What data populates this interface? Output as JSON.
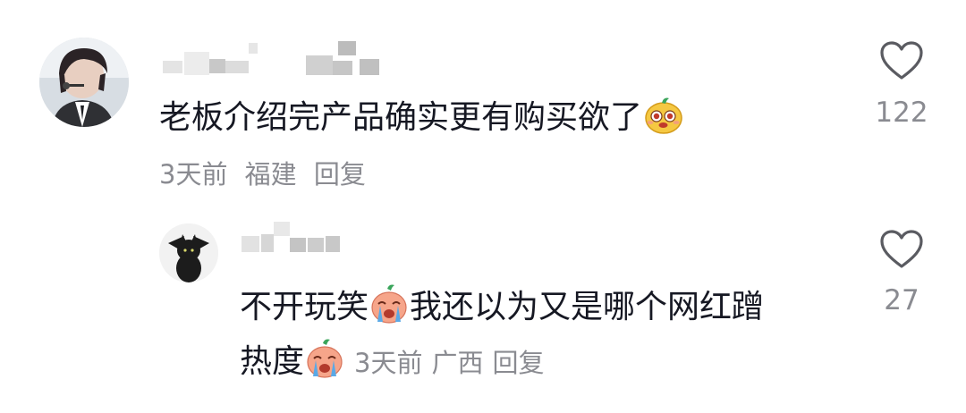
{
  "comments": [
    {
      "text": "老板介绍完产品确实更有购买欲了",
      "emoji": "yellow-face-emoji",
      "time": "3天前",
      "location": "福建",
      "reply_label": "回复",
      "likes": "122"
    }
  ],
  "reply": {
    "text_line1": "不开玩笑",
    "emoji": "crying-face-emoji",
    "text_line1_b": "我还以为又是哪个网红蹭",
    "text_line2": "热度",
    "time": "3天前",
    "location": "广西",
    "reply_label": "回复",
    "likes": "27"
  },
  "colors": {
    "text": "#161823",
    "meta": "#8a8b91",
    "icon": "#5a5b61"
  },
  "icons": {
    "like": "heart-outline-icon"
  }
}
